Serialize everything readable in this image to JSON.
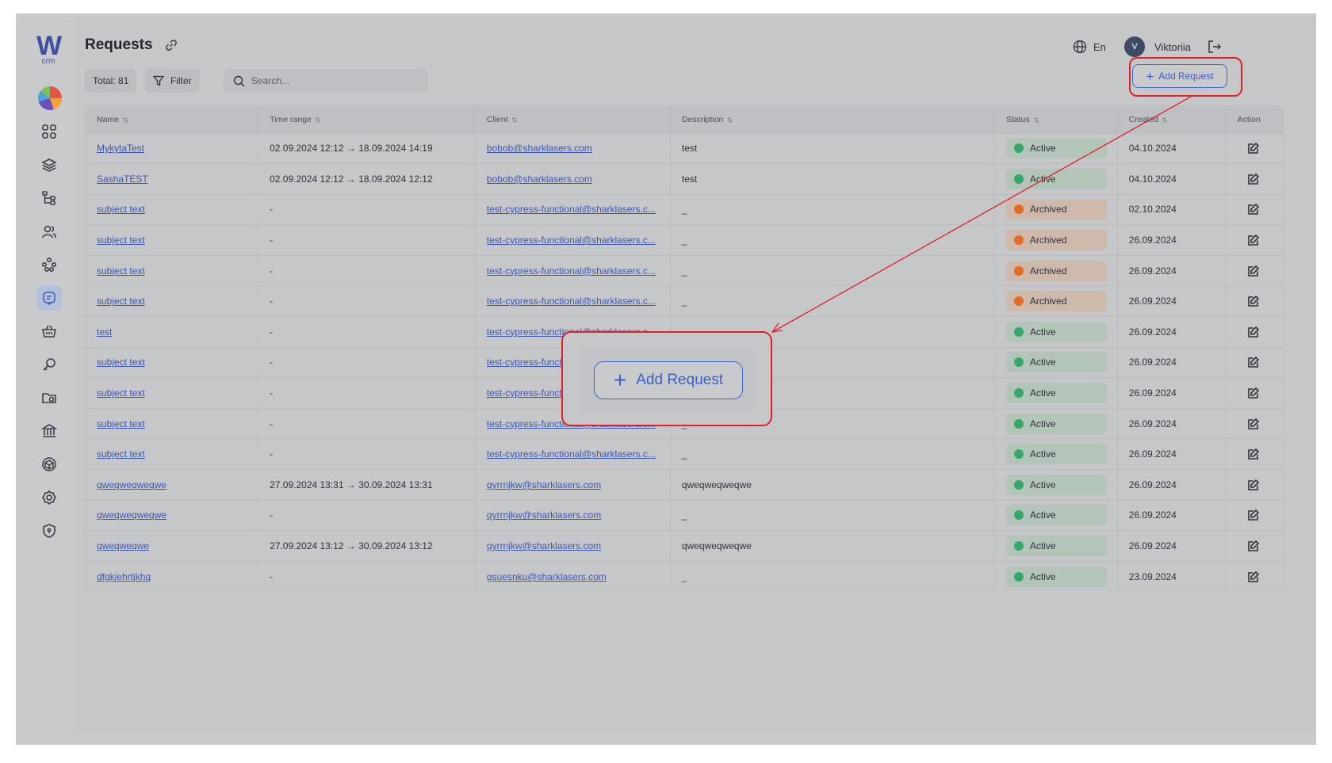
{
  "app": {
    "logo_text": "W",
    "logo_sub": "crm"
  },
  "header": {
    "title": "Requests",
    "total_label": "Total: 81",
    "filter_label": "Filter",
    "search_placeholder": "Search...",
    "language": "En",
    "user_initial": "V",
    "user_name": "Viktoriia",
    "add_button_label": "Add Request"
  },
  "sidebar": {
    "items": [
      {
        "icon": "dashboard-grid-icon"
      },
      {
        "icon": "layers-icon"
      },
      {
        "icon": "hierarchy-icon"
      },
      {
        "icon": "users-icon"
      },
      {
        "icon": "network-icon"
      },
      {
        "icon": "requests-icon",
        "active": true
      },
      {
        "icon": "basket-icon"
      },
      {
        "icon": "key-icon"
      },
      {
        "icon": "folder-icon"
      },
      {
        "icon": "bank-icon"
      },
      {
        "icon": "cube-icon"
      },
      {
        "icon": "settings-icon"
      },
      {
        "icon": "shield-icon"
      }
    ]
  },
  "table": {
    "columns": [
      "Name",
      "Time range",
      "Client",
      "Description",
      "Status",
      "Created",
      "Action"
    ],
    "rows": [
      {
        "name": "MykytaTest",
        "time_range": "02.09.2024 12:12 → 18.09.2024 14:19",
        "client": "bobob@sharklasers.com",
        "description": "test",
        "status": "Active",
        "created": "04.10.2024"
      },
      {
        "name": "SashaTEST",
        "time_range": "02.09.2024 12:12 → 18.09.2024 12:12",
        "client": "bobob@sharklasers.com",
        "description": "test",
        "status": "Active",
        "created": "04.10.2024"
      },
      {
        "name": "subject text",
        "time_range": "-",
        "client": "test-cypress-functional@sharklasers.c...",
        "description": "_",
        "status": "Archived",
        "created": "02.10.2024"
      },
      {
        "name": "subject text",
        "time_range": "-",
        "client": "test-cypress-functional@sharklasers.c...",
        "description": "_",
        "status": "Archived",
        "created": "26.09.2024"
      },
      {
        "name": "subject text",
        "time_range": "-",
        "client": "test-cypress-functional@sharklasers.c...",
        "description": "_",
        "status": "Archived",
        "created": "26.09.2024"
      },
      {
        "name": "subject text",
        "time_range": "-",
        "client": "test-cypress-functional@sharklasers.c...",
        "description": "_",
        "status": "Archived",
        "created": "26.09.2024"
      },
      {
        "name": "test",
        "time_range": "-",
        "client": "test-cypress-functional@sharklasers.c...",
        "description": "_",
        "status": "Active",
        "created": "26.09.2024"
      },
      {
        "name": "subject text",
        "time_range": "-",
        "client": "test-cypress-functional@sharklasers.c...",
        "description": "_",
        "status": "Active",
        "created": "26.09.2024"
      },
      {
        "name": "subject text",
        "time_range": "-",
        "client": "test-cypress-functional@sharklasers.c...",
        "description": "_",
        "status": "Active",
        "created": "26.09.2024"
      },
      {
        "name": "subject text",
        "time_range": "-",
        "client": "test-cypress-functional@sharklasers.c...",
        "description": "_",
        "status": "Active",
        "created": "26.09.2024"
      },
      {
        "name": "subject text",
        "time_range": "-",
        "client": "test-cypress-functional@sharklasers.c...",
        "description": "_",
        "status": "Active",
        "created": "26.09.2024"
      },
      {
        "name": "qweqweqweqwe",
        "time_range": "27.09.2024 13:31 → 30.09.2024 13:31",
        "client": "qyrrnjkw@sharklasers.com",
        "description": "qweqweqweqwe",
        "status": "Active",
        "created": "26.09.2024"
      },
      {
        "name": "qweqweqweqwe",
        "time_range": "-",
        "client": "qyrrnjkw@sharklasers.com",
        "description": "_",
        "status": "Active",
        "created": "26.09.2024"
      },
      {
        "name": "qweqweqwe",
        "time_range": "27.09.2024 13:12 → 30.09.2024 13:12",
        "client": "qyrrnjkw@sharklasers.com",
        "description": "qweqweqweqwe",
        "status": "Active",
        "created": "26.09.2024"
      },
      {
        "name": "dfgkjehrtjkhq",
        "time_range": "-",
        "client": "gsuesnku@sharklasers.com",
        "description": "_",
        "status": "Active",
        "created": "23.09.2024"
      }
    ]
  },
  "callout": {
    "zoom_label": "Add Request"
  },
  "colors": {
    "accent": "#3a5fcc",
    "highlight": "#e0202a",
    "active": "#33a86a",
    "archived": "#e46a26"
  }
}
